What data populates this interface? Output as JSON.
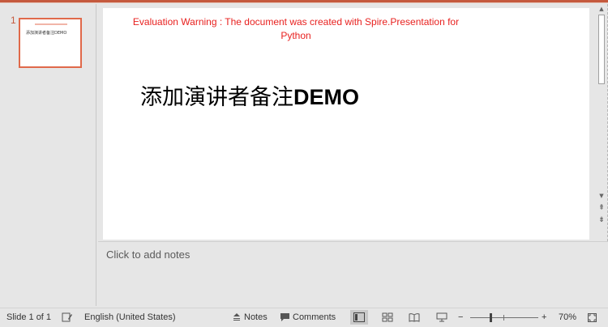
{
  "thumbnails": [
    {
      "number": "1",
      "title": "添加演讲者备注DEMO"
    }
  ],
  "slide": {
    "warning": "Evaluation Warning : The document was created with Spire.Presentation for Python",
    "title_cjk": "添加演讲者备注",
    "title_latin": "DEMO"
  },
  "notes": {
    "placeholder": "Click to add notes"
  },
  "statusbar": {
    "slide_info": "Slide 1 of 1",
    "language": "English (United States)",
    "notes_label": "Notes",
    "comments_label": "Comments",
    "zoom_minus": "−",
    "zoom_plus": "+",
    "zoom_level": "70%"
  },
  "colors": {
    "accent": "#c55a3e",
    "thumb_border": "#e0694a",
    "warning_text": "#e8211f"
  }
}
